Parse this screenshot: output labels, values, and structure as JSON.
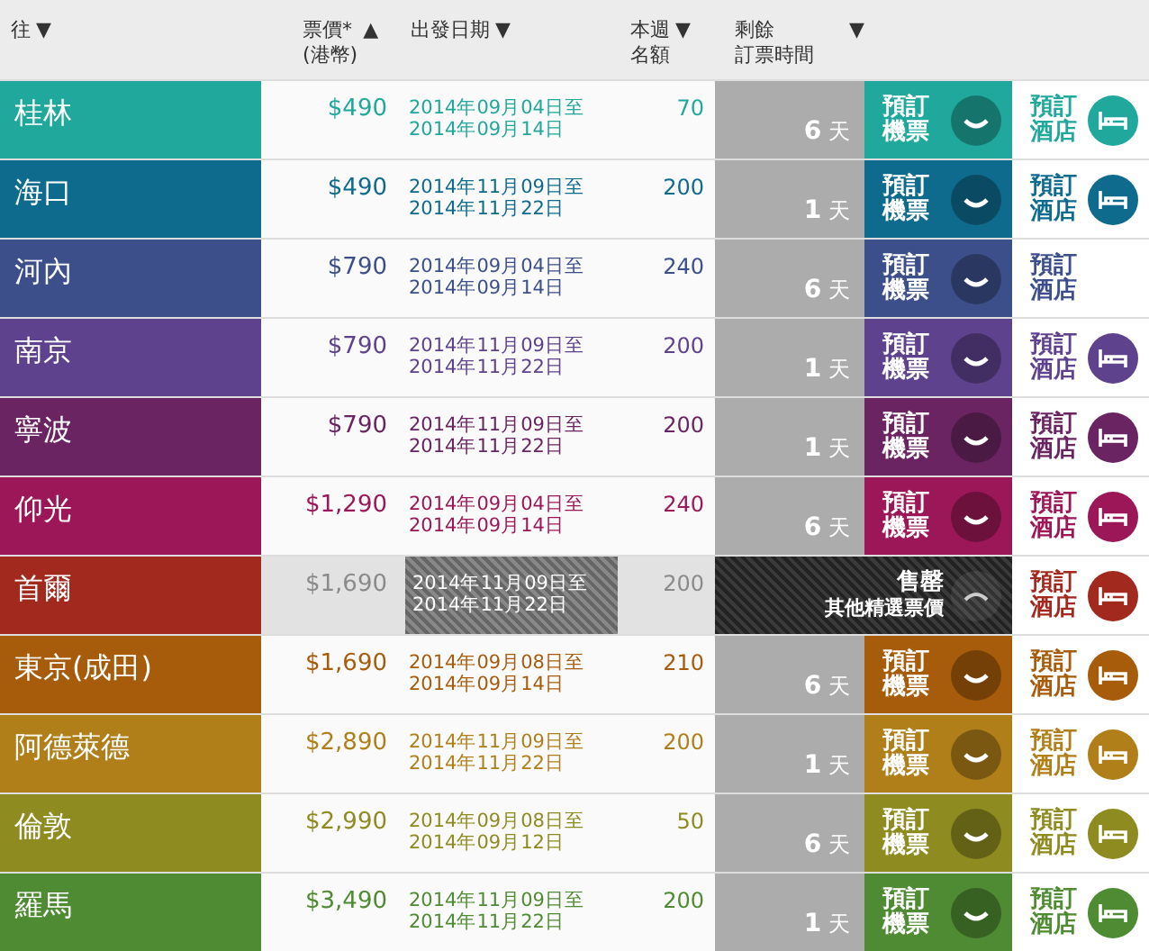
{
  "columns": [
    {
      "label": "往",
      "arrow": "▼"
    },
    {
      "label": "票價*",
      "sub": "(港幣)",
      "arrow": "▲"
    },
    {
      "label": "出發日期",
      "arrow": "▼"
    },
    {
      "label": "本週",
      "sub": "名額",
      "arrow": "▼"
    },
    {
      "label": "剩餘",
      "sub": "訂票時間",
      "arrow": "▼"
    }
  ],
  "rows": [
    {
      "kind": "available",
      "city": "桂林",
      "color": "#1fa89b",
      "price": "$490",
      "date_from": "2014年09月04日至",
      "date_to": "2014年09月14日",
      "quota": "70",
      "days": "6",
      "unit": "天",
      "ticket": [
        "預訂",
        "機票"
      ],
      "hotel": [
        "預訂",
        "酒店"
      ],
      "hotel_icon": true
    },
    {
      "kind": "available",
      "city": "海口",
      "color": "#0f6b8e",
      "price": "$490",
      "date_from": "2014年11月09日至",
      "date_to": "2014年11月22日",
      "quota": "200",
      "days": "1",
      "unit": "天",
      "ticket": [
        "預訂",
        "機票"
      ],
      "hotel": [
        "預訂",
        "酒店"
      ],
      "hotel_icon": true
    },
    {
      "kind": "available",
      "city": "河內",
      "color": "#3c4f8b",
      "price": "$790",
      "date_from": "2014年09月04日至",
      "date_to": "2014年09月14日",
      "quota": "240",
      "days": "6",
      "unit": "天",
      "ticket": [
        "預訂",
        "機票"
      ],
      "hotel": [
        "預訂",
        "酒店"
      ],
      "hotel_icon": false
    },
    {
      "kind": "available",
      "city": "南京",
      "color": "#5f428e",
      "price": "$790",
      "date_from": "2014年11月09日至",
      "date_to": "2014年11月22日",
      "quota": "200",
      "days": "1",
      "unit": "天",
      "ticket": [
        "預訂",
        "機票"
      ],
      "hotel": [
        "預訂",
        "酒店"
      ],
      "hotel_icon": true
    },
    {
      "kind": "available",
      "city": "寧波",
      "color": "#6a2462",
      "price": "$790",
      "date_from": "2014年11月09日至",
      "date_to": "2014年11月22日",
      "quota": "200",
      "days": "1",
      "unit": "天",
      "ticket": [
        "預訂",
        "機票"
      ],
      "hotel": [
        "預訂",
        "酒店"
      ],
      "hotel_icon": true
    },
    {
      "kind": "available",
      "city": "仰光",
      "color": "#9b1757",
      "price": "$1,290",
      "date_from": "2014年09月04日至",
      "date_to": "2014年09月14日",
      "quota": "240",
      "days": "6",
      "unit": "天",
      "ticket": [
        "預訂",
        "機票"
      ],
      "hotel": [
        "預訂",
        "酒店"
      ],
      "hotel_icon": true
    },
    {
      "kind": "sold_out",
      "city": "首爾",
      "color": "#a2291e",
      "price": "$1,690",
      "date_from": "2014年11月09日至",
      "date_to": "2014年11月22日",
      "quota": "200",
      "ticket": [
        "售罄",
        "其他精選票價"
      ],
      "hotel": [
        "預訂",
        "酒店"
      ],
      "hotel_icon": true
    },
    {
      "kind": "available",
      "city": "東京(成田)",
      "color": "#a65c0b",
      "price": "$1,690",
      "date_from": "2014年09月08日至",
      "date_to": "2014年09月14日",
      "quota": "210",
      "days": "6",
      "unit": "天",
      "ticket": [
        "預訂",
        "機票"
      ],
      "hotel": [
        "預訂",
        "酒店"
      ],
      "hotel_icon": true
    },
    {
      "kind": "available",
      "city": "阿德萊德",
      "color": "#b07f19",
      "price": "$2,890",
      "date_from": "2014年11月09日至",
      "date_to": "2014年11月22日",
      "quota": "200",
      "days": "1",
      "unit": "天",
      "ticket": [
        "預訂",
        "機票"
      ],
      "hotel": [
        "預訂",
        "酒店"
      ],
      "hotel_icon": true
    },
    {
      "kind": "available",
      "city": "倫敦",
      "color": "#8e8b20",
      "price": "$2,990",
      "date_from": "2014年09月08日至",
      "date_to": "2014年09月12日",
      "quota": "50",
      "days": "6",
      "unit": "天",
      "ticket": [
        "預訂",
        "機票"
      ],
      "hotel": [
        "預訂",
        "酒店"
      ],
      "hotel_icon": true
    },
    {
      "kind": "available",
      "city": "羅馬",
      "color": "#4f8b32",
      "price": "$3,490",
      "date_from": "2014年11月09日至",
      "date_to": "2014年11月22日",
      "quota": "200",
      "days": "1",
      "unit": "天",
      "ticket": [
        "預訂",
        "機票"
      ],
      "hotel": [
        "預訂",
        "酒店"
      ],
      "hotel_icon": true
    }
  ]
}
